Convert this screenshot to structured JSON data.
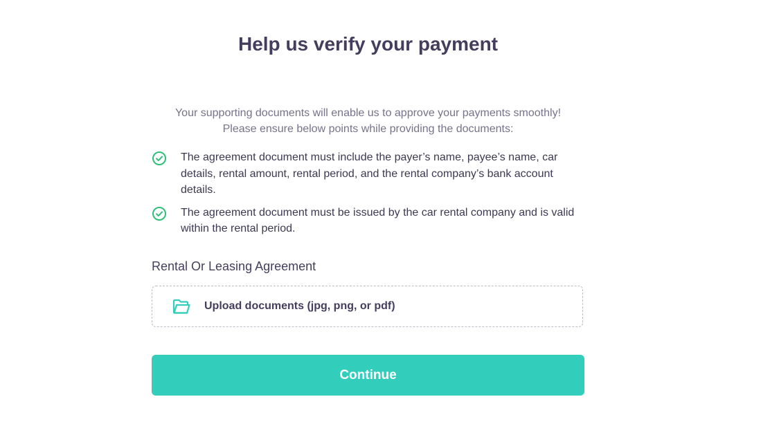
{
  "header": {
    "title": "Help us verify your payment"
  },
  "intro": {
    "line1": "Your supporting documents will enable us to approve your payments smoothly!",
    "line2": "Please ensure below points while providing the documents:"
  },
  "requirements": [
    {
      "text": "The agreement document must include the payer’s name, payee’s name, car details, rental amount, rental period, and the rental company’s bank account details.",
      "icon": "check-circle-icon"
    },
    {
      "text": "The agreement document must be issued by the car rental company and is valid within the rental period.",
      "icon": "check-circle-icon"
    }
  ],
  "document_section": {
    "label": "Rental Or Leasing Agreement",
    "upload_label": "Upload documents (jpg, png, or pdf)",
    "upload_icon": "folder-open-icon"
  },
  "actions": {
    "continue_label": "Continue"
  },
  "colors": {
    "accent": "#33cdbb",
    "check": "#2fbf7a",
    "heading": "#453d5c",
    "muted": "#76728a"
  }
}
